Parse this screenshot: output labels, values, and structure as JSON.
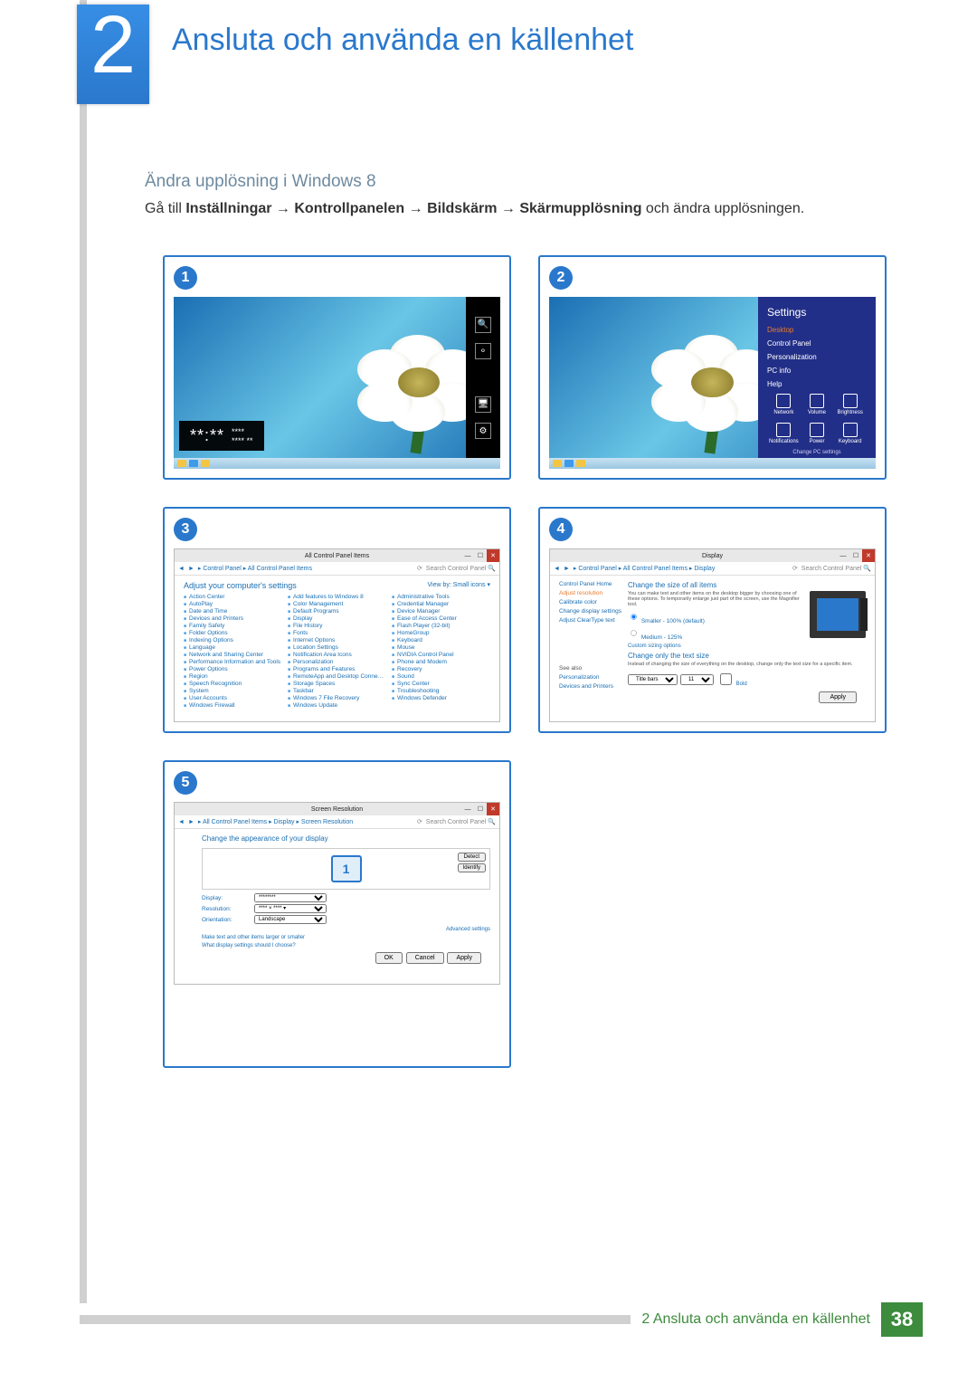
{
  "chapter": {
    "number": "2",
    "title": "Ansluta och använda en källenhet"
  },
  "section": {
    "subheading": "Ändra upplösning i Windows 8",
    "instruction_prefix": "Gå till ",
    "path_items": [
      "Inställningar",
      "Kontrollpanelen",
      "Bildskärm",
      "Skärmupplösning"
    ],
    "instruction_suffix": " och ändra upplösningen."
  },
  "badges": {
    "b1": "1",
    "b2": "2",
    "b3": "3",
    "b4": "4",
    "b5": "5"
  },
  "panel1": {
    "time_big": "**:**",
    "time_small1": "****",
    "time_small2": "**** **"
  },
  "panel2": {
    "title": "Settings",
    "items": [
      "Desktop",
      "Control Panel",
      "Personalization",
      "PC info",
      "Help"
    ],
    "icons": [
      "Network",
      "Volume",
      "Brightness",
      "Notifications",
      "Power",
      "Keyboard"
    ],
    "change": "Change PC settings"
  },
  "panel3": {
    "title": "All Control Panel Items",
    "breadcrumb": "▸ Control Panel ▸ All Control Panel Items",
    "search": "Search Control Panel",
    "heading": "Adjust your computer's settings",
    "viewby": "View by:  Small icons ▾",
    "items": [
      "Action Center",
      "Add features to Windows 8",
      "Administrative Tools",
      "AutoPlay",
      "Color Management",
      "Credential Manager",
      "Date and Time",
      "Default Programs",
      "Device Manager",
      "Devices and Printers",
      "Display",
      "Ease of Access Center",
      "Family Safety",
      "File History",
      "Flash Player (32-bit)",
      "Folder Options",
      "Fonts",
      "HomeGroup",
      "Indexing Options",
      "Internet Options",
      "Keyboard",
      "Language",
      "Location Settings",
      "Mouse",
      "Network and Sharing Center",
      "Notification Area Icons",
      "NVIDIA Control Panel",
      "Performance Information and Tools",
      "Personalization",
      "Phone and Modem",
      "Power Options",
      "Programs and Features",
      "Recovery",
      "Region",
      "RemoteApp and Desktop Connections",
      "Sound",
      "Speech Recognition",
      "Storage Spaces",
      "Sync Center",
      "System",
      "Taskbar",
      "Troubleshooting",
      "User Accounts",
      "Windows 7 File Recovery",
      "Windows Defender",
      "Windows Firewall",
      "Windows Update"
    ]
  },
  "panel4": {
    "title": "Display",
    "breadcrumb": "▸ Control Panel ▸ All Control Panel Items ▸ Display",
    "search": "Search Control Panel",
    "side": [
      "Control Panel Home",
      "Adjust resolution",
      "Calibrate color",
      "Change display settings",
      "Adjust ClearType text"
    ],
    "h1": "Change the size of all items",
    "desc": "You can make text and other items on the desktop bigger by choosing one of these options. To temporarily enlarge just part of the screen, use the Magnifier tool.",
    "opt1": "Smaller - 100% (default)",
    "opt2": "Medium - 125%",
    "link1": "Custom sizing options",
    "h2": "Change only the text size",
    "desc2": "Instead of changing the size of everything on the desktop, change only the text size for a specific item.",
    "field_label": "Title bars",
    "size": "11",
    "bold": "Bold",
    "apply": "Apply",
    "seealso": "See also",
    "seealso_items": [
      "Personalization",
      "Devices and Printers"
    ]
  },
  "panel5": {
    "title": "Screen Resolution",
    "breadcrumb": "▸ All Control Panel Items ▸ Display ▸ Screen Resolution",
    "search": "Search Control Panel",
    "h1": "Change the appearance of your display",
    "detect": "Detect",
    "identify": "Identify",
    "monitor_num": "1",
    "fields": {
      "display_label": "Display:",
      "display_value": "********",
      "resolution_label": "Resolution:",
      "resolution_value": "**** × **** ▾",
      "orientation_label": "Orientation:",
      "orientation_value": "Landscape"
    },
    "adv": "Advanced settings",
    "link1": "Make text and other items larger or smaller",
    "link2": "What display settings should I choose?",
    "ok": "OK",
    "cancel": "Cancel",
    "apply": "Apply"
  },
  "footer": {
    "text": "2 Ansluta och använda en källenhet",
    "page": "38"
  }
}
